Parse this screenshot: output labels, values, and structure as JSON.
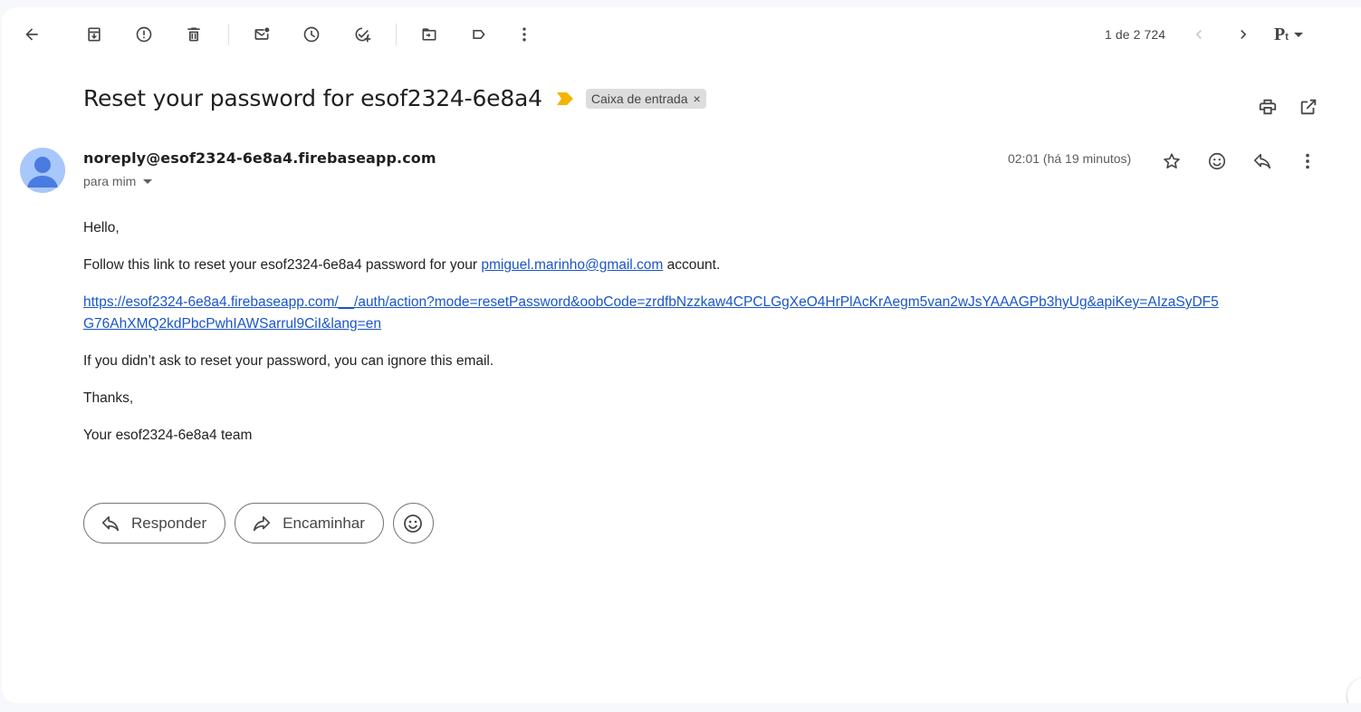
{
  "toolbar": {
    "pager_text": "1 de 2 724",
    "lang_text": "P",
    "lang_sub": "t"
  },
  "email": {
    "subject": "Reset your password for esof2324-6e8a4",
    "label": "Caixa de entrada",
    "label_remove": "×",
    "sender": "noreply@esof2324-6e8a4.firebaseapp.com",
    "to_text": "para mim",
    "time": "02:01 (há 19 minutos)",
    "body": {
      "greeting": "Hello,",
      "line1_prefix": "Follow this link to reset your esof2324-6e8a4 password for your ",
      "line1_email": "pmiguel.marinho@gmail.com",
      "line1_suffix": " account.",
      "reset_link": "https://esof2324-6e8a4.firebaseapp.com/__/auth/action?mode=resetPassword&oobCode=zrdfbNzzkaw4CPCLGgXeO4HrPlAcKrAegm5van2wJsYAAAGPb3hyUg&apiKey=AIzaSyDF5G76AhXMQ2kdPbcPwhIAWSarrul9CiI&lang=en",
      "ignore_line": "If you didn’t ask to reset your password, you can ignore this email.",
      "thanks": "Thanks,",
      "signature": "Your esof2324-6e8a4 team"
    }
  },
  "actions": {
    "reply_label": "Responder",
    "forward_label": "Encaminhar"
  },
  "colors": {
    "link": "#1a55c8",
    "importance": "#f4b400",
    "avatar_bg": "#a8c7fa",
    "avatar_fg": "#4a7be0"
  }
}
